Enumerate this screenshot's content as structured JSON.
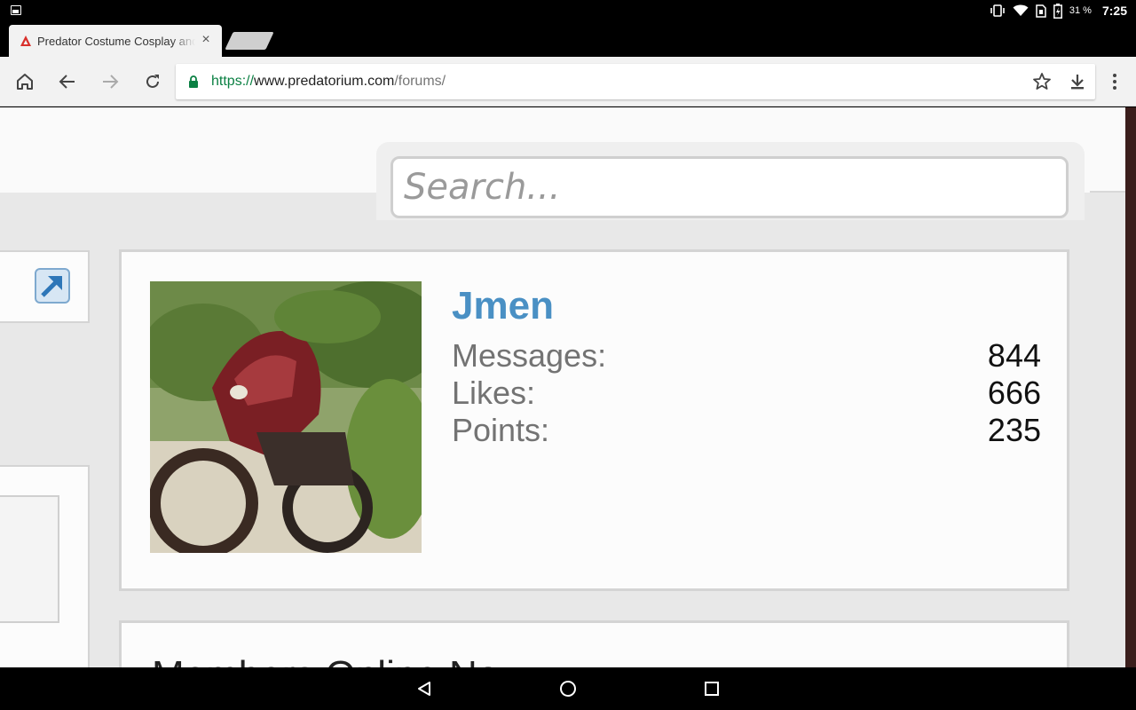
{
  "status_bar": {
    "battery_percent": "31 %",
    "time": "7:25",
    "icons": [
      "gallery-notification-icon",
      "vibrate-icon",
      "wifi-icon",
      "sim-icon",
      "battery-charging-icon"
    ]
  },
  "browser": {
    "tab": {
      "title": "Predator Costume Cosplay and",
      "close_glyph": "×"
    },
    "toolbar": {
      "url_scheme": "https://",
      "url_host": "www.predatorium.com",
      "url_path": "/forums/"
    }
  },
  "page": {
    "search": {
      "placeholder": "Search..."
    },
    "profile": {
      "username": "Jmen",
      "stats": [
        {
          "label": "Messages:",
          "value": "844"
        },
        {
          "label": "Likes:",
          "value": "666"
        },
        {
          "label": "Points:",
          "value": "235"
        }
      ]
    },
    "members_online": {
      "title": "Members Online Now"
    }
  },
  "colors": {
    "username": "#4a90c4",
    "secure_scheme": "#0b8043",
    "page_bg": "#e8e8e8"
  }
}
